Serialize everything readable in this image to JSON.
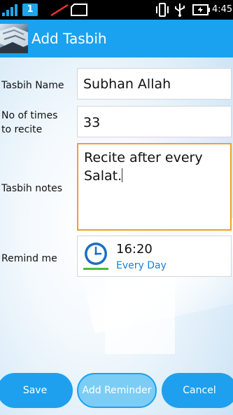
{
  "status_bar": {
    "sim_badge": "1",
    "time": "4:45",
    "icons": [
      "signal-icon",
      "no-sim-icon",
      "sd-card-icon",
      "vibrate-icon",
      "usb-icon",
      "battery-icon"
    ]
  },
  "app_bar": {
    "title": "Add Tasbih",
    "color": "#1aa2f0"
  },
  "form": {
    "name_label": "Tasbih Name",
    "name_value": "Subhan Allah",
    "count_label_line1": "No of times",
    "count_label_line2": "to recite",
    "count_value": "33",
    "notes_label": "Tasbih notes",
    "notes_line1": "Recite after every",
    "notes_line2": "Salat.",
    "remind_label": "Remind me",
    "remind_time": "16:20",
    "remind_repeat": "Every Day"
  },
  "buttons": {
    "save": "Save",
    "add_reminder": "Add Reminder",
    "cancel": "Cancel"
  },
  "colors": {
    "accent": "#1ea0ee",
    "notes_focus_border": "#f0a030",
    "reminder_repeat_text": "#1a7fd6",
    "clock_underline": "#4cbb3a"
  }
}
